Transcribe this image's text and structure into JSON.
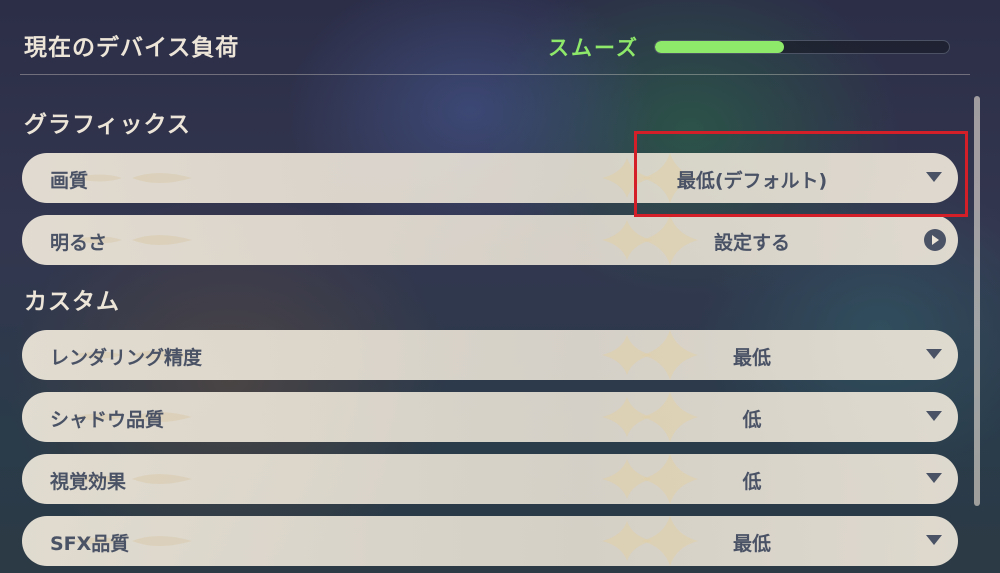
{
  "header": {
    "title": "現在のデバイス負荷",
    "load_status": "スムーズ",
    "load_level": 0.44,
    "load_color": "#8ee86a"
  },
  "sections": {
    "graphics": {
      "title": "グラフィックス",
      "quality": {
        "label": "画質",
        "value": "最低(デフォルト)"
      },
      "brightness": {
        "label": "明るさ",
        "value": "設定する"
      }
    },
    "custom": {
      "title": "カスタム",
      "render_res": {
        "label": "レンダリング精度",
        "value": "最低"
      },
      "shadow": {
        "label": "シャドウ品質",
        "value": "低"
      },
      "visual_fx": {
        "label": "視覚効果",
        "value": "低"
      },
      "sfx": {
        "label": "SFX品質",
        "value": "最低"
      }
    }
  },
  "colors": {
    "highlight_border": "#d41e28",
    "row_bg": "#ece5d8",
    "row_text": "#4a5366"
  },
  "icons": {
    "dropdown": "triangle-down-icon",
    "open_settings": "play-circle-icon"
  }
}
